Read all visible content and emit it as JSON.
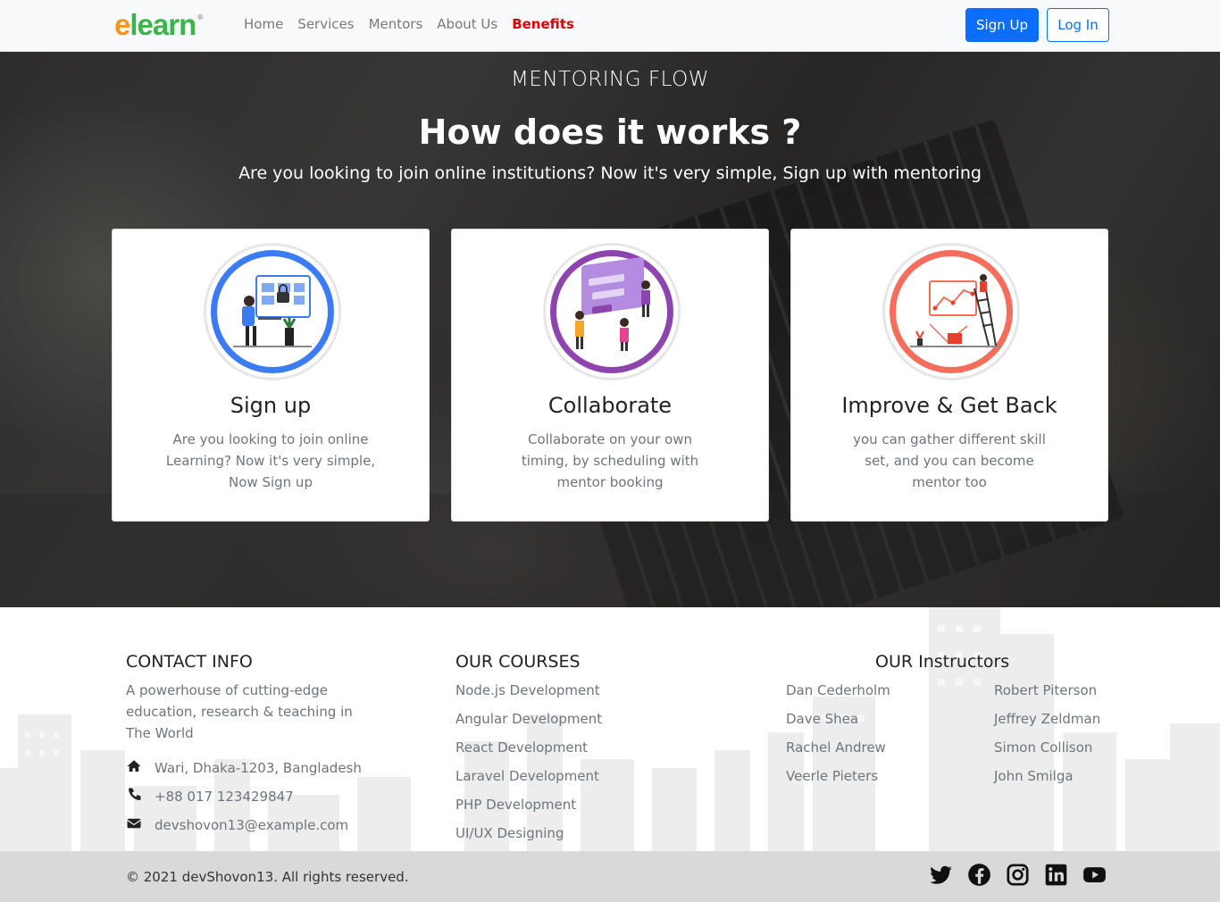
{
  "navbar": {
    "logo_main": "e",
    "logo_rest": "learn",
    "links": [
      {
        "label": "Home"
      },
      {
        "label": "Services"
      },
      {
        "label": "Mentors"
      },
      {
        "label": "About Us"
      },
      {
        "label": "Benefits",
        "active": true
      }
    ],
    "signup_label": "Sign Up",
    "login_label": "Log In"
  },
  "hero": {
    "subtitle": "MENTORING FLOW",
    "title": "How does it works ?",
    "description": "Are you looking to join online institutions? Now it's very simple, Sign up with mentoring"
  },
  "cards": [
    {
      "title": "Sign up",
      "text": "Are you looking to join online Learning? Now it's very simple, Now Sign up",
      "color": "#3b7cf5"
    },
    {
      "title": "Collaborate",
      "text": "Collaborate on your own timing, by scheduling with mentor booking",
      "color": "#8e44ad"
    },
    {
      "title": "Improve & Get Back",
      "text": "you can gather different skill set, and you can become mentor too",
      "color": "#f56e5b"
    }
  ],
  "footer": {
    "contact": {
      "title": "CONTACT INFO",
      "text": "A powerhouse of cutting-edge education, research & teaching in The World",
      "address": "Wari, Dhaka-1203, Bangladesh",
      "phone": "+88 017 123429847",
      "email": "devshovon13@example.com"
    },
    "courses": {
      "title": "OUR COURSES",
      "items": [
        "Node.js Development",
        "Angular Development",
        "React Development",
        "Laravel Development",
        "PHP Development",
        "UI/UX Designing"
      ]
    },
    "instructors": {
      "title": "OUR Instructors",
      "col1": [
        "Dan Cederholm",
        "Dave Shea",
        "Rachel Andrew",
        "Veerle Pieters"
      ],
      "col2": [
        "Robert Piterson",
        "Jeffrey Zeldman",
        "Simon Collison",
        "John Smilga"
      ]
    },
    "copyright": "© 2021 devShovon13. All rights reserved.",
    "socials": [
      "twitter-icon",
      "facebook-icon",
      "instagram-icon",
      "linkedin-icon",
      "youtube-icon"
    ]
  }
}
